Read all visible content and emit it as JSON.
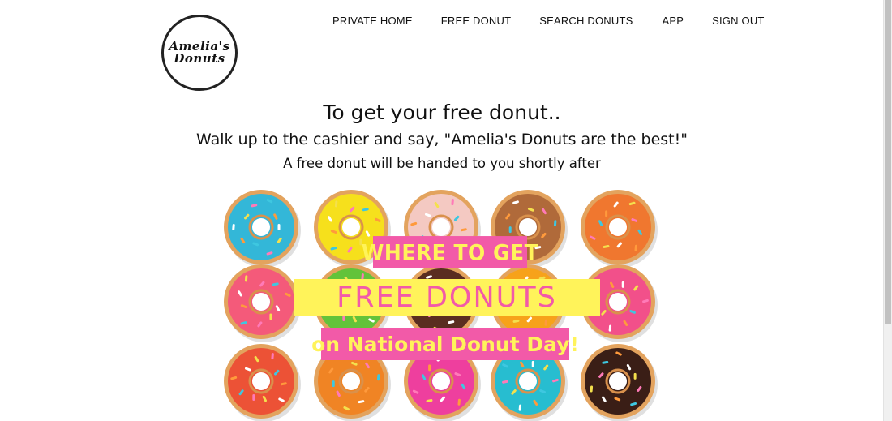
{
  "logo": {
    "line1": "Amelia's",
    "line2": "Donuts"
  },
  "nav": {
    "items": [
      {
        "label": "PRIVATE HOME"
      },
      {
        "label": "FREE DONUT"
      },
      {
        "label": "SEARCH DONUTS"
      },
      {
        "label": "APP"
      },
      {
        "label": "SIGN OUT"
      }
    ]
  },
  "main": {
    "title": "To get your free donut..",
    "line1": "Walk up to the cashier and say, \"Amelia's Donuts are the best!\"",
    "line2": "A free donut will be handed to you shortly after"
  },
  "hero": {
    "banner_top": "WHERE TO GET",
    "banner_mid": "FREE DONUTS",
    "banner_bottom": "on National Donut Day!",
    "colors": {
      "pink": "#f25aa8",
      "yellow": "#fff35a"
    },
    "donut_colors": [
      [
        "#33b7d8",
        "#f6e01c",
        "#f4c9c2",
        "#b06a3a",
        "#f0772f"
      ],
      [
        "#f45a7a",
        "#62c33a",
        "#5a2d20",
        "#f7a21a",
        "#f2508a"
      ],
      [
        "#ec5236",
        "#f08424",
        "#ee3f9e",
        "#27bdd0",
        "#3a1e16"
      ]
    ]
  }
}
